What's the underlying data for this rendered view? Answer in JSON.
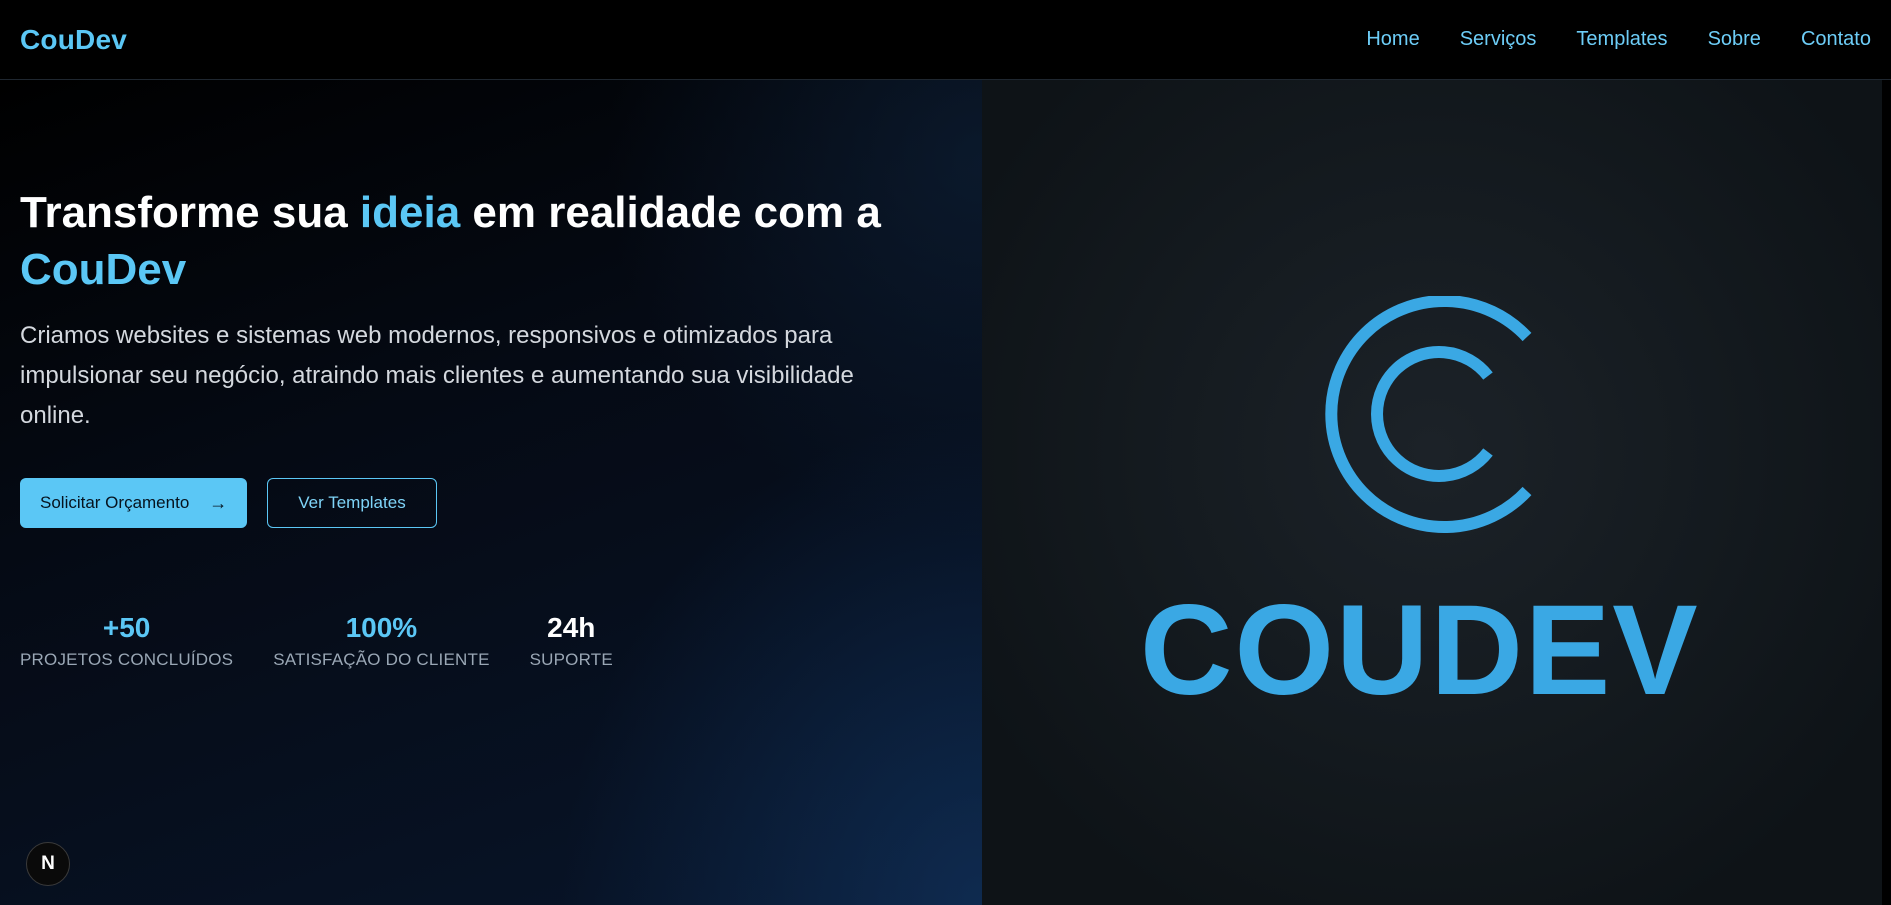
{
  "nav": {
    "brand": "CouDev",
    "links": [
      "Home",
      "Serviços",
      "Templates",
      "Sobre",
      "Contato"
    ]
  },
  "hero": {
    "headline_part1": "Transforme sua ",
    "headline_accent1": "ideia",
    "headline_part2": " em realidade com a",
    "headline_accent2": "CouDev",
    "subtitle": "Criamos websites e sistemas web modernos, responsivos e otimizados para impulsionar seu negócio, atraindo mais clientes e aumentando sua visibilidade online.",
    "primary_button": "Solicitar Orçamento",
    "primary_button_icon": "arrow-right-icon",
    "secondary_button": "Ver Templates",
    "stats": [
      {
        "value": "+50",
        "label": "PROJETOS CONCLUÍDOS"
      },
      {
        "value": "100%",
        "label": "SATISFAÇÃO DO CLIENTE"
      },
      {
        "value": "24h",
        "label": "SUPORTE"
      }
    ]
  },
  "logo": {
    "wordmark": "COUDEV",
    "color": "#3aa8e4"
  },
  "dev_badge": "N",
  "colors": {
    "accent": "#5bc7f5",
    "background": "#000000"
  }
}
